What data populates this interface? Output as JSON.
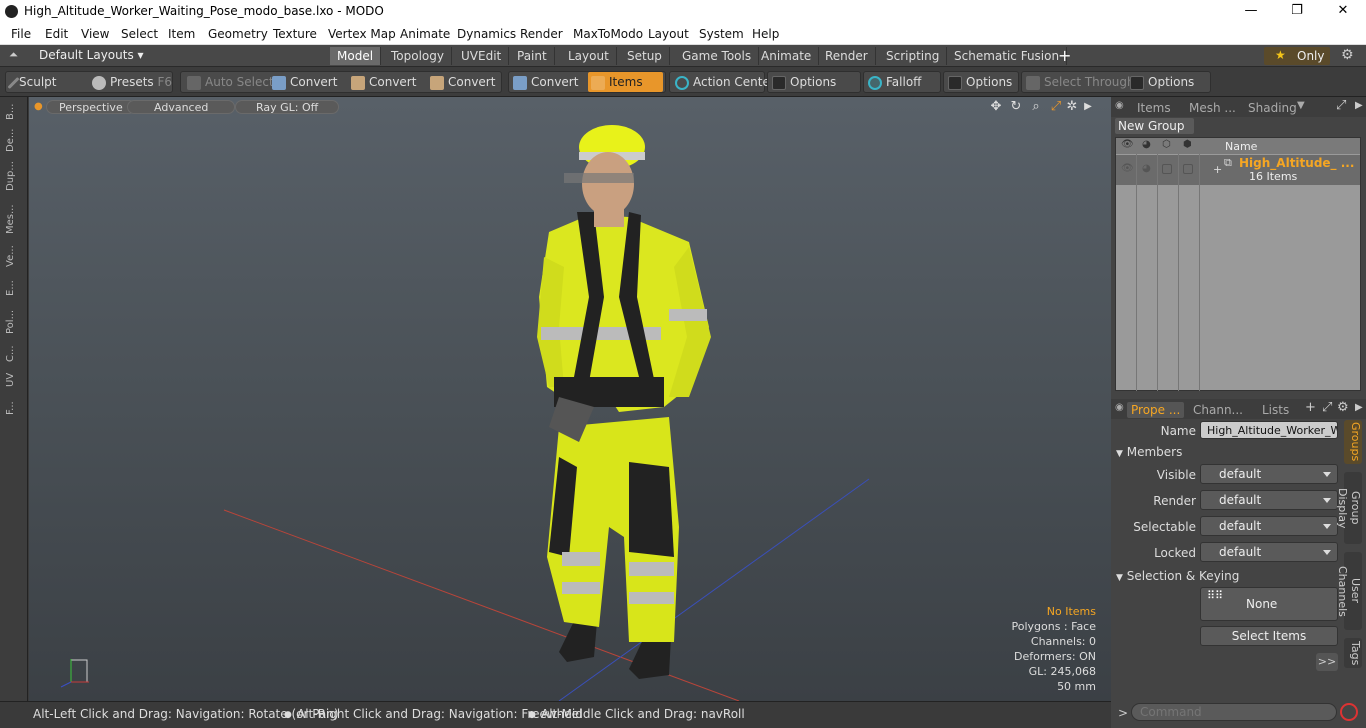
{
  "window": {
    "title": "High_Altitude_Worker_Waiting_Pose_modo_base.lxo - MODO",
    "minimize": "—",
    "restore": "❐",
    "close": "✕"
  },
  "menu": [
    "File",
    "Edit",
    "View",
    "Select",
    "Item",
    "Geometry",
    "Texture",
    "Vertex Map",
    "Animate",
    "Dynamics",
    "Render",
    "MaxToModo",
    "Layout",
    "System",
    "Help"
  ],
  "layouts": {
    "selector": "Default Layouts ▾",
    "tabs": [
      "Model",
      "Topology",
      "UVEdit",
      "Paint",
      "Layout",
      "Setup",
      "Game Tools",
      "Animate",
      "Render",
      "Scripting",
      "Schematic Fusion"
    ],
    "active": "Model",
    "add": "+",
    "only": "Only"
  },
  "toolbar": {
    "sculpt": "Sculpt",
    "presets": "Presets",
    "presets_key": "F6",
    "auto_select": "Auto Select",
    "convert1": "Convert",
    "convert2": "Convert",
    "convert3": "Convert",
    "convert4": "Convert",
    "items": "Items",
    "action_center": "Action Center",
    "options1": "Options",
    "falloff": "Falloff",
    "options2": "Options",
    "select_through": "Select Through",
    "options3": "Options"
  },
  "left_tabs": [
    "B...",
    "De...",
    "Dup...",
    "Mes...",
    "Ve...",
    "E...",
    "Pol...",
    "C...",
    "UV",
    "F..."
  ],
  "viewport": {
    "perspective": "Perspective",
    "advanced": "Advanced",
    "raygl": "Ray GL: Off",
    "stats": {
      "items": "No Items",
      "polygons": "Polygons : Face",
      "channels": "Channels: 0",
      "deformers": "Deformers: ON",
      "gl": "GL: 245,068",
      "scale": "50 mm"
    }
  },
  "status": {
    "hint1": "Alt-Left Click and Drag: Navigation: Rotate (or Pan)",
    "hint2": "Alt-Right Click and Drag: Navigation: Freewheel",
    "hint3": "Alt-Middle Click and Drag: navRoll"
  },
  "items_panel": {
    "tabs": [
      "Items",
      "Mesh ...",
      "Shading"
    ],
    "new_group": "New Group",
    "col_name": "Name",
    "group_name": "High_Altitude_ ...",
    "group_count": "16 Items"
  },
  "properties": {
    "tabs": [
      "Prope ...",
      "Chann...",
      "Lists"
    ],
    "name_label": "Name",
    "name_value": "High_Altitude_Worker_Wa",
    "members": "Members",
    "visible_label": "Visible",
    "visible_value": "default",
    "render_label": "Render",
    "render_value": "default",
    "selectable_label": "Selectable",
    "selectable_value": "default",
    "locked_label": "Locked",
    "locked_value": "default",
    "sel_keying": "Selection & Keying",
    "none": "None",
    "select_items": "Select Items",
    "more": ">>",
    "side_tabs": [
      "Groups",
      "Group Display",
      "User Channels",
      "Tags"
    ]
  },
  "command": {
    "prompt": ">",
    "placeholder": "Command"
  },
  "colors": {
    "accent": "#f5a623",
    "vest": "#e8f21a"
  }
}
